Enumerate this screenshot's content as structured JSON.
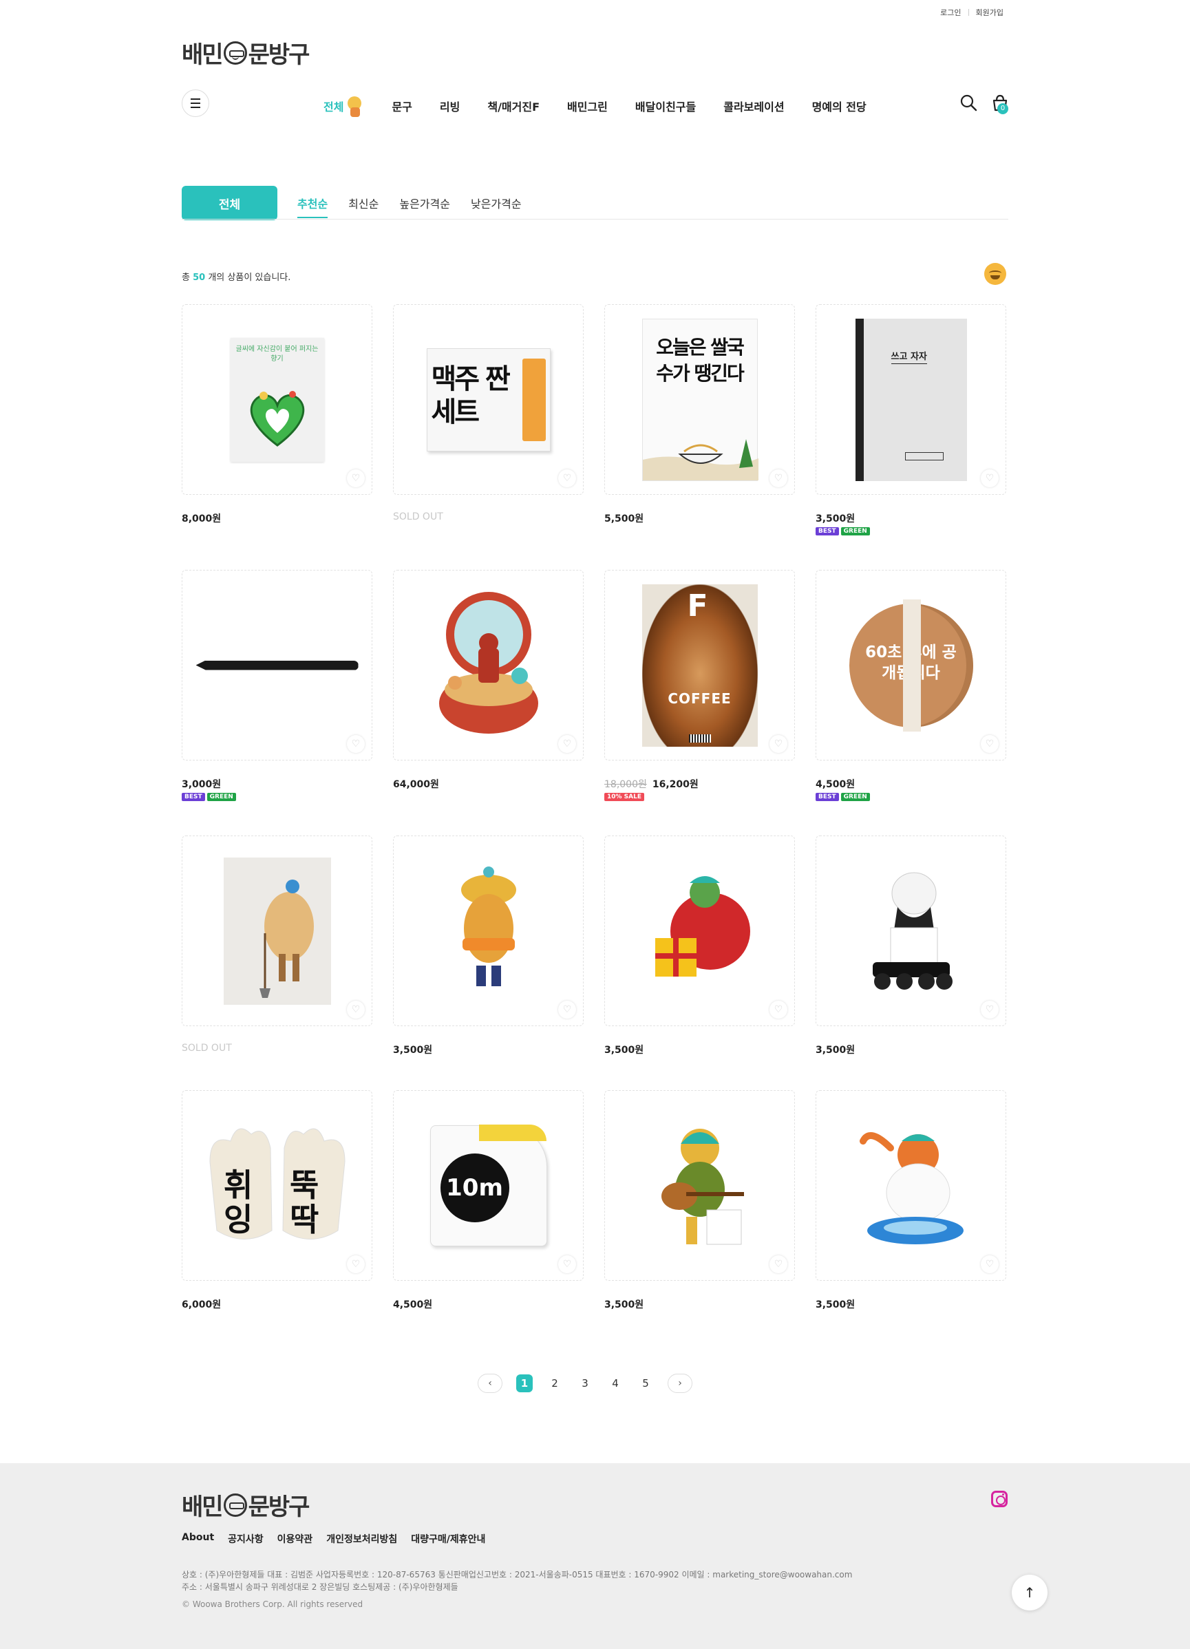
{
  "util": {
    "login": "로그인",
    "signup": "회원가입"
  },
  "header": {
    "logo": {
      "part1": "배민",
      "part2": "문방구"
    },
    "nav": [
      "전체",
      "문구",
      "리빙",
      "책/매거진F",
      "배민그린",
      "배달이친구들",
      "콜라보레이션",
      "명예의 전당"
    ],
    "cart_count": "0"
  },
  "filter": {
    "category": "전체",
    "sorts": [
      "추천순",
      "최신순",
      "높은가격순",
      "낮은가격순"
    ],
    "active_sort": "추천순"
  },
  "summary": {
    "prefix": "총",
    "count": "50",
    "suffix": "개의 상품이 있습니다."
  },
  "colors": {
    "accent": "#2ac1bc",
    "best": "#6b3fd6",
    "green": "#1fa346",
    "sale": "#f04b57"
  },
  "products": [
    {
      "price": "8,000원",
      "image_text": "글씨에 자신감이 붙어 퍼지는 향기",
      "image": "heart-sticker-icon"
    },
    {
      "price": "SOLD OUT",
      "image_text": "맥주 짠 세트",
      "image": "beer-set-box"
    },
    {
      "price": "5,500원",
      "image_text": "오늘은 쌀국수가 땡긴다",
      "image": "notebook-noodle"
    },
    {
      "price": "3,500원",
      "image_text": "쓰고 자자",
      "image": "notebook-gray",
      "badges": [
        "BEST",
        "GREEN"
      ]
    },
    {
      "price": "3,000원",
      "image": "pen-black",
      "badges": [
        "BEST",
        "GREEN"
      ]
    },
    {
      "price": "64,000원",
      "image": "music-box-figure"
    },
    {
      "old_price": "18,000원",
      "price": "16,200원",
      "image_text": "COFFEE",
      "image": "magazine-f-coffee",
      "badges": [
        "10% SALE"
      ]
    },
    {
      "price": "4,500원",
      "image_text": "60초 후에 공개됩니다",
      "image": "round-tape-box",
      "badges": [
        "BEST",
        "GREEN"
      ]
    },
    {
      "price": "SOLD OUT",
      "image": "potato-postcard"
    },
    {
      "price": "3,500원",
      "image": "potato-figure"
    },
    {
      "price": "3,500원",
      "image": "gift-figure"
    },
    {
      "price": "3,500원",
      "image": "robot-figure"
    },
    {
      "price": "6,000원",
      "image_text": "뚝딱",
      "image": "work-gloves"
    },
    {
      "price": "4,500원",
      "image_text": "10m",
      "image": "tape-measure"
    },
    {
      "price": "3,500원",
      "image": "guitar-figure"
    },
    {
      "price": "3,500원",
      "image": "cat-float-figure"
    }
  ],
  "pagination": {
    "pages": [
      "1",
      "2",
      "3",
      "4",
      "5"
    ],
    "current": "1"
  },
  "footer": {
    "links": [
      "About",
      "공지사항",
      "이용약관",
      "개인정보처리방침",
      "대량구매/제휴안내"
    ],
    "info_line1": "상호 : (주)우아한형제들    대표 : 김범준    사업자등록번호 : 120-87-65763    통신판매업신고번호 : 2021-서울송파-0515    대표번호 : 1670-9902    이메일 : marketing_store@woowahan.com",
    "info_line2": "주소 : 서울특별시 송파구 위례성대로 2 장은빌딩    호스팅제공 : (주)우아한형제들",
    "copyright": "© Woowa Brothers Corp. All rights reserved"
  }
}
